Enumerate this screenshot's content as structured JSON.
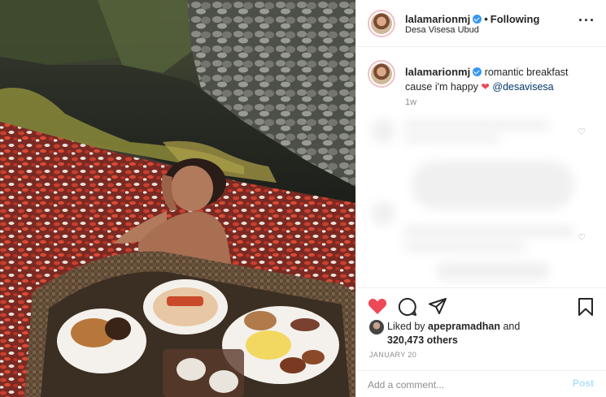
{
  "post": {
    "username": "lalamarionmj",
    "follow_status": "Following",
    "location": "Desa Visesa Ubud",
    "more_icon": "more-horizontal-icon",
    "photo_subject": "woman in petal-strewn pool with floating breakfast tray"
  },
  "caption": {
    "username": "lalamarionmj",
    "text": "romantic breakfast cause i'm happy",
    "emoji": "❤",
    "mention": "@desavisesa",
    "age": "1w"
  },
  "actions": {
    "like_icon": "heart-filled-icon",
    "comment_icon": "comment-icon",
    "share_icon": "share-icon",
    "save_icon": "bookmark-icon",
    "liked_by_prefix": "Liked by",
    "liked_by_user": "apepramadhan",
    "and_word": "and",
    "others_count": "320,473 others",
    "date": "JANUARY 20"
  },
  "comment_box": {
    "placeholder": "Add a comment...",
    "post_label": "Post"
  },
  "colors": {
    "like_red": "#ed4956",
    "verified_blue": "#3897f0",
    "link_blue": "#00376b",
    "post_disabled": "#b2dffc",
    "muted": "#8e8e8e"
  }
}
